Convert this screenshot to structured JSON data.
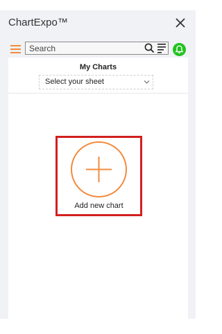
{
  "header": {
    "title": "ChartExpo™",
    "close_icon": "close-icon"
  },
  "toolbar": {
    "menu_icon": "hamburger-menu-icon",
    "search_placeholder": "Search",
    "search_value": "",
    "search_icon": "magnifier-icon",
    "filter_icon": "filter-list-icon",
    "notify_icon": "bell-icon"
  },
  "main": {
    "section_title": "My Charts",
    "sheet_select": {
      "selected": "Select your sheet",
      "icon": "chevron-down-icon"
    },
    "add_chart": {
      "label": "Add new chart",
      "icon": "plus-circle-icon"
    }
  },
  "colors": {
    "accent": "#f28a3c",
    "notify_green": "#21c21f",
    "highlight_red": "#d21f1f",
    "panel_bg": "#f0f2f5"
  }
}
